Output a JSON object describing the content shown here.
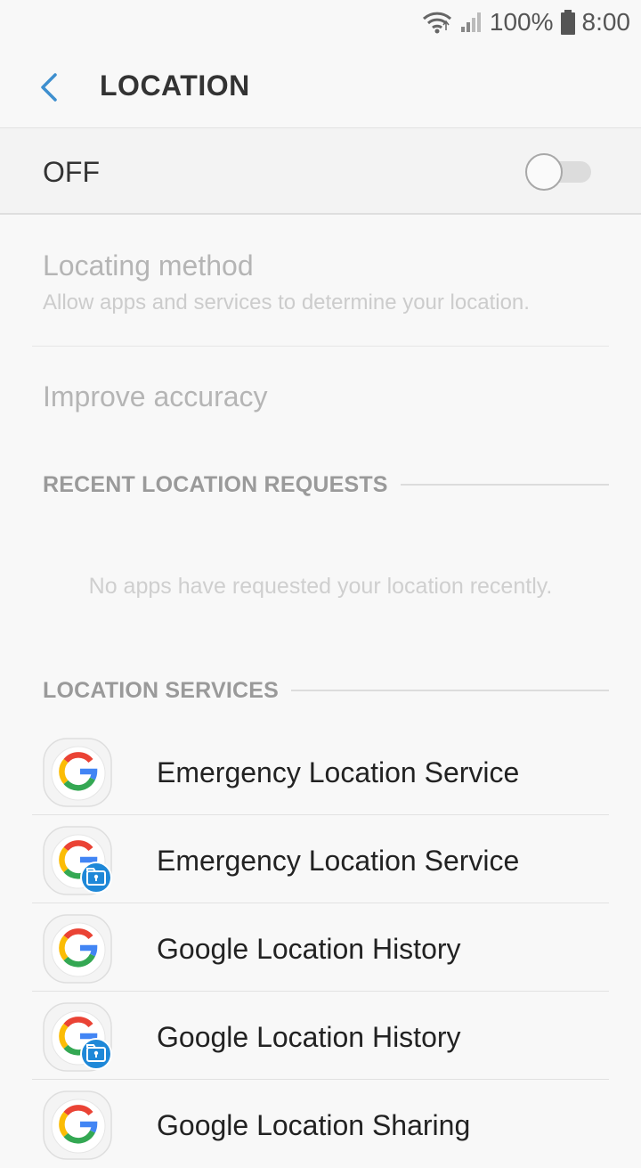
{
  "status_bar": {
    "battery": "100%",
    "time": "8:00",
    "icons": [
      "wifi-icon",
      "signal-icon",
      "battery-icon"
    ]
  },
  "header": {
    "back_icon": "back-arrow-icon",
    "title": "LOCATION"
  },
  "master_switch": {
    "label": "OFF",
    "state": "off"
  },
  "settings": [
    {
      "title": "Locating method",
      "subtitle": "Allow apps and services to determine your location."
    },
    {
      "title": "Improve accuracy"
    }
  ],
  "recent_requests": {
    "header": "RECENT LOCATION REQUESTS",
    "empty_message": "No apps have requested your location recently."
  },
  "location_services": {
    "header": "LOCATION SERVICES",
    "items": [
      {
        "label": "Emergency Location Service",
        "icon": "google-icon",
        "badge": false
      },
      {
        "label": "Emergency Location Service",
        "icon": "google-secure-folder-icon",
        "badge": true
      },
      {
        "label": "Google Location History",
        "icon": "google-icon",
        "badge": false
      },
      {
        "label": "Google Location History",
        "icon": "google-secure-folder-icon",
        "badge": true
      },
      {
        "label": "Google Location Sharing",
        "icon": "google-icon",
        "badge": false
      }
    ]
  },
  "colors": {
    "accent": "#3e8fcf",
    "badge": "#1e88d8",
    "google_blue": "#4285f4",
    "google_red": "#ea4335",
    "google_yellow": "#fbbc05",
    "google_green": "#34a853"
  }
}
